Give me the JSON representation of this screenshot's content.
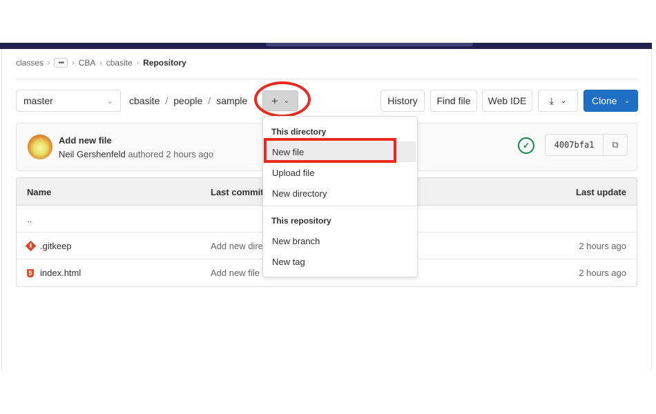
{
  "breadcrumb": {
    "items": [
      "classes",
      "CBA",
      "cbasite"
    ],
    "more_label": "•••",
    "current": "Repository",
    "separator": "›"
  },
  "toolbar": {
    "branch": "master",
    "path": [
      "cbasite",
      "people",
      "sample"
    ],
    "path_separator": "/",
    "add_plus": "+",
    "chevron": "⌄",
    "history_label": "History",
    "find_file_label": "Find file",
    "web_ide_label": "Web IDE",
    "download_icon": "⤓",
    "clone_label": "Clone"
  },
  "commit": {
    "title": "Add new file",
    "author": "Neil Gershenfeld",
    "meta": "authored 2 hours ago",
    "pipeline_status": "passed",
    "pipeline_glyph": "✓",
    "sha": "4007bfa1",
    "copy_glyph": "⧉"
  },
  "table": {
    "headers": {
      "name": "Name",
      "last_commit": "Last commit",
      "last_update": "Last update"
    },
    "rows": [
      {
        "name": "..",
        "message": "",
        "updated": ""
      },
      {
        "name": ".gitkeep",
        "message": "Add new directory",
        "updated": "2 hours ago",
        "icon": "git-icon"
      },
      {
        "name": "index.html",
        "message": "Add new file",
        "updated": "2 hours ago",
        "icon": "html5-icon"
      }
    ]
  },
  "dropdown": {
    "section1": "This directory",
    "section1_items": [
      "New file",
      "Upload file",
      "New directory"
    ],
    "section2": "This repository",
    "section2_items": [
      "New branch",
      "New tag"
    ],
    "highlighted": "New file"
  },
  "colors": {
    "header_bg": "#211f4f",
    "primary": "#1f6fc5",
    "annotation": "#ea2a1f",
    "success": "#108548"
  }
}
